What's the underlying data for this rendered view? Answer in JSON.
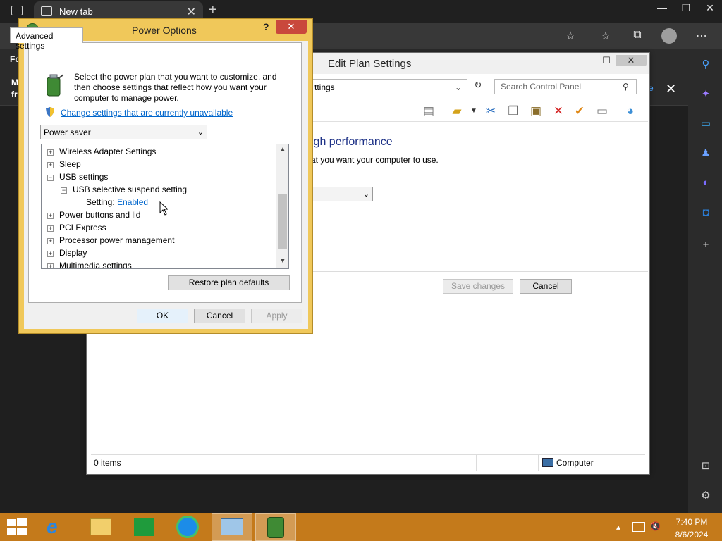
{
  "browser": {
    "tab_title": "New tab",
    "close_glyph": "✕",
    "new_tab_glyph": "+",
    "partial_left_1": "Fo",
    "partial_left_2": "M",
    "partial_left_3": "fr",
    "partial_right": "e"
  },
  "control_panel": {
    "window_title": "Edit Plan Settings",
    "address_text": "ttings",
    "search_placeholder": "Search Control Panel",
    "heading": "igh performance",
    "subtext": "at you want your computer to use.",
    "save_label": "Save changes",
    "cancel_label": "Cancel",
    "status_items": "0 items",
    "status_location": "Computer"
  },
  "power_options": {
    "title": "Power Options",
    "help_glyph": "?",
    "close_glyph": "✕",
    "tab_label": "Advanced settings",
    "intro": "Select the power plan that you want to customize, and then choose settings that reflect how you want your computer to manage power.",
    "change_link": "Change settings that are currently unavailable",
    "plan_selected": "Power saver",
    "tree": [
      {
        "toggle": "+",
        "label": "Wireless Adapter Settings"
      },
      {
        "toggle": "+",
        "label": "Sleep"
      },
      {
        "toggle": "−",
        "label": "USB settings"
      },
      {
        "toggle": "−",
        "label": "USB selective suspend setting"
      },
      {
        "label": "Setting:",
        "value": "Enabled"
      },
      {
        "toggle": "+",
        "label": "Power buttons and lid"
      },
      {
        "toggle": "+",
        "label": "PCI Express"
      },
      {
        "toggle": "+",
        "label": "Processor power management"
      },
      {
        "toggle": "+",
        "label": "Display"
      },
      {
        "toggle": "+",
        "label": "Multimedia settings"
      }
    ],
    "restore_label": "Restore plan defaults",
    "ok_label": "OK",
    "cancel_label": "Cancel",
    "apply_label": "Apply"
  },
  "taskbar": {
    "time": "7:40 PM",
    "date": "8/6/2024"
  },
  "colors": {
    "taskbar": "#c47a1b",
    "dialog_frame": "#f0c85a",
    "link": "#0066cc",
    "heading": "#1e3287"
  }
}
